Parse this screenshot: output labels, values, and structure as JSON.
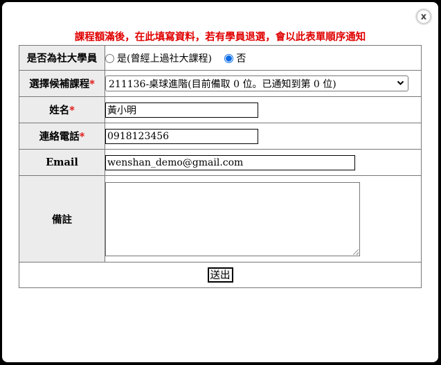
{
  "dialog": {
    "close_label": "x",
    "notice": "課程額滿後，在此填寫資料，若有學員退選，會以此表單順序通知"
  },
  "form": {
    "is_member": {
      "label": "是否為社大學員",
      "options": [
        "是(曾經上過社大課程)",
        "否"
      ],
      "selected": "否"
    },
    "course": {
      "label": "選擇候補課程",
      "required_mark": "*",
      "selected": "211136-桌球進階(目前備取 0 位。已通知到第 0 位)"
    },
    "name": {
      "label": "姓名",
      "required_mark": "*",
      "value": "黃小明"
    },
    "phone": {
      "label": "連絡電話",
      "required_mark": "*",
      "value": "0918123456"
    },
    "email": {
      "label": "Email",
      "value": "wenshan_demo@gmail.com"
    },
    "note": {
      "label": "備註",
      "value": ""
    },
    "submit_label": "送出"
  },
  "colors": {
    "notice": "#e00000",
    "required": "#e00000",
    "label_bg": "#ececec",
    "radio_accent": "#0a6ce6",
    "backdrop": "#000000"
  }
}
